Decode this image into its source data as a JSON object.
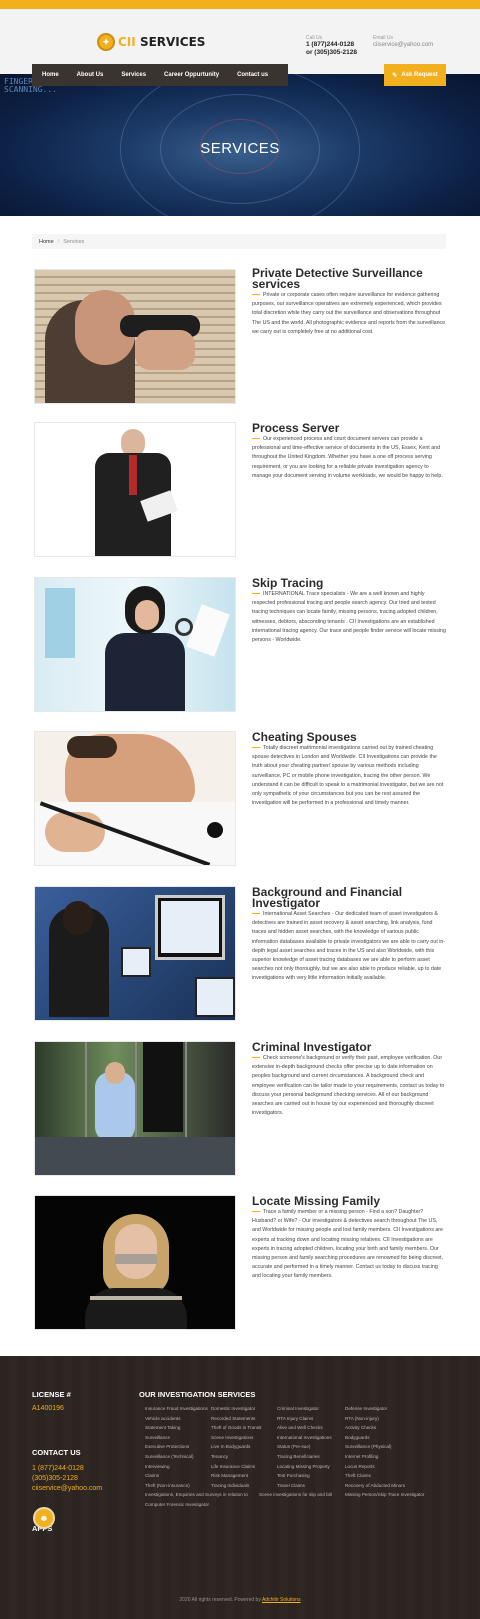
{
  "header": {
    "logo_text_a": "CII",
    "logo_text_b": "SERVICES",
    "call_label": "Call Us",
    "phone_1": "1 (877)244-0128",
    "phone_2": "or (305)305-2128",
    "email_label": "Email Us",
    "email": "ciiservice@yahoo.com"
  },
  "nav": {
    "items": [
      "Home",
      "About Us",
      "Services",
      "Career Oppurtunity",
      "Contact us"
    ],
    "request_button": "Ask Request"
  },
  "hero": {
    "title": "SERVICES",
    "scan_text": "FINGER PRINT SCANNING..."
  },
  "breadcrumb": {
    "home": "Home",
    "current": "Services"
  },
  "services": [
    {
      "title": "Private Detective Surveillance services",
      "desc": "Private or corporate cases often require surveillance for evidence gathering purposes, our surveillance operatives are extremely experienced, which provides total discretion while they carry out the surveillance and observations throughout The US and the world. All photographic evidence and reports from the surveillance we carry out is completely free at no additional cost."
    },
    {
      "title": "Process Server",
      "desc": "Our experienced process and court document servers can provide a professional and time-effective service of documents in the US, Essex, Kent and throughout the United Kingdom. Whether you have a one off process serving requirement, or you are looking for a reliable private investigation agency to manage your document serving in volume workloads, we would be happy to help."
    },
    {
      "title": "Skip Tracing",
      "desc": "INTERNATIONAL Trace specialists - We are a well known and highly respected professional tracing and people search agency. Our tried and tested tracing techniques can locate family, missing persons, tracing adopted children, witnesses, debtors, absconding tenants . CII Investigations are an established international tracing agency. Our trace and people finder service will locate missing persons - Worldwide."
    },
    {
      "title": "Cheating Spouses",
      "desc": "Totally discreet matrimonial investigations carried out by trained cheating spouse detectives in London and Worldwide. CII Investigations can provide the truth about your cheating partner/ spouse by various methods including surveillance, PC or mobile phone investigation, tracing the other person. We understand it can be difficult to speak to a matrimonial investigator, but we are not only sympathetic of your circumstances but you can be rest assured the investigation will be performed in a professional and timely manner."
    },
    {
      "title": "Background and Financial Investigator",
      "desc": "International Asset Searches - Our dedicated team of asset investigators & detectives are trained in asset recovery & asset searching, link analysis, fund traces and hidden asset searches, with the knowledge of various public information databases available to private investigators we are able to carry out in-depth legal asset searches and traces in the US and also Worldwide, with this superior knowledge of asset tracing databases we are able to perform asset searches not only thoroughly, but we are also able to produce reliable, up to date investigations with very little information initially available."
    },
    {
      "title": "Criminal Investigator",
      "desc": "Check someone's background or verify their past, employee verification. Our extensive in-depth background checks offer precise up to date information on peoples background and current circumstances. A background check and employee verification can be tailor made to your requirements, contact us today to discuss your personal background checking services. All of our background searches are carried out in house by our experienced and thoroughly discreet investigators."
    },
    {
      "title": "Locate Missing Family",
      "desc": "Trace a family member or a missing person - Find a son? Daughter? Husband? or Wife? - Our investigators & detectives search throughout The US, and Worldwide for missing people and lost family members. CII Investigations are experts at tracking down and locating missing relatives. CII Investigations are experts in tracing adopted children, locating your birth and family members. Our missing person and family searching procedures are renowned for being discreet, accurate and performed in a timely manner. Contact us today to discuss tracing and locating your family members."
    }
  ],
  "footer": {
    "license_heading": "LICENSE #",
    "license_value": "A1400196",
    "contact_heading": "CONTACT US",
    "contact_phone_1": "1 (877)244-0128",
    "contact_phone_2": "(305)305-2128",
    "contact_email": "ciiservice@yahoo.com",
    "apps_heading": "APPS",
    "services_heading": "OUR INVESTIGATION SERVICES",
    "service_rows": [
      [
        "Insurance Fraud Investigations",
        "Domestic Investigator",
        "Criminal Investigator",
        "Defense Investigator"
      ],
      [
        "Vehicle accidents",
        "Recorded Statements",
        "RTA Injury Claims",
        "RTA (Non-injury)"
      ],
      [
        "Statement Taking",
        "Theft of Goods in Transit",
        "Alive and Well Checks",
        "Activity Checks"
      ],
      [
        "Surveillance",
        "Scene Investigations",
        "International Investigations",
        "Bodyguards"
      ],
      [
        "Executive Protections",
        "Live In Bodyguards",
        "Status (Pre-sue)",
        "Surveillance (Physical)"
      ],
      [
        "Surveillance (Technical)",
        "Tenancy",
        "Tracing Beneficiaries",
        "Internet Profiling"
      ],
      [
        "Interviewing",
        "Life Insurance Claims",
        "Locating Missing Property",
        "Locus Reports"
      ],
      [
        "Claims",
        "Risk Management",
        "Test Purchasing",
        "Theft Claims"
      ],
      [
        "Theft (Non-insurance)",
        "Tracing Individuals",
        "Travel Claims",
        "Recovery of Abducted Minors"
      ],
      [
        "Investigations, Enquiries and Surveys in relation to",
        "Scene investigations for slip and fall",
        "Missing Person/Skip Trace Investigator",
        ""
      ],
      [
        "Computer Forensic Investigator",
        "",
        "",
        ""
      ]
    ],
    "copyright_text": "2020 All rights reserved. Powered by",
    "copyright_link": "Adchitir Solutions"
  },
  "colors": {
    "accent": "#f2b01e",
    "nav_bg": "#3a3431",
    "footer_bg": "#2b2420"
  }
}
